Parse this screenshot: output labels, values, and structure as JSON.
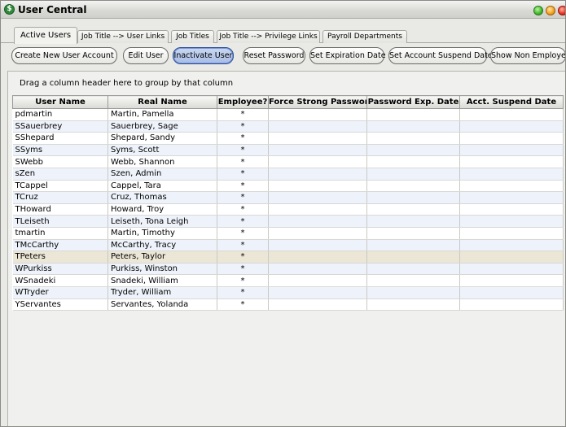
{
  "window": {
    "title": "User Central",
    "app_icon_glyph": "$"
  },
  "tabs": [
    {
      "label": "Active Users",
      "active": true
    },
    {
      "label": "Job Title --> User Links",
      "active": false
    },
    {
      "label": "Job Titles",
      "active": false
    },
    {
      "label": "Job Title --> Privilege Links",
      "active": false
    },
    {
      "label": "Payroll Departments",
      "active": false
    }
  ],
  "toolbar": {
    "create_label": "Create New User Account",
    "edit_label": "Edit User",
    "inactivate_label": "Inactivate User",
    "reset_password_label": "Reset Password",
    "set_expiration_label": "Set Expiration Date",
    "set_suspend_label": "Set Account Suspend Date",
    "show_non_employees_label": "Show Non Employees"
  },
  "grid": {
    "group_hint": "Drag a column header here to group by that column",
    "columns": [
      "User Name",
      "Real Name",
      "Employee?",
      "Force Strong Password?",
      "Password Exp. Date",
      "Acct. Suspend Date"
    ],
    "rows": [
      {
        "user": "pdmartin",
        "real": "Martin, Pamella",
        "employee": "*",
        "force": "",
        "exp": "",
        "suspend": ""
      },
      {
        "user": "SSauerbrey",
        "real": "Sauerbrey, Sage",
        "employee": "*",
        "force": "",
        "exp": "",
        "suspend": ""
      },
      {
        "user": "SShepard",
        "real": "Shepard, Sandy",
        "employee": "*",
        "force": "",
        "exp": "",
        "suspend": ""
      },
      {
        "user": "SSyms",
        "real": "Syms, Scott",
        "employee": "*",
        "force": "",
        "exp": "",
        "suspend": ""
      },
      {
        "user": "SWebb",
        "real": "Webb, Shannon",
        "employee": "*",
        "force": "",
        "exp": "",
        "suspend": ""
      },
      {
        "user": "sZen",
        "real": "Szen, Admin",
        "employee": "*",
        "force": "",
        "exp": "",
        "suspend": ""
      },
      {
        "user": "TCappel",
        "real": "Cappel, Tara",
        "employee": "*",
        "force": "",
        "exp": "",
        "suspend": ""
      },
      {
        "user": "TCruz",
        "real": "Cruz, Thomas",
        "employee": "*",
        "force": "",
        "exp": "",
        "suspend": ""
      },
      {
        "user": "THoward",
        "real": "Howard, Troy",
        "employee": "*",
        "force": "",
        "exp": "",
        "suspend": ""
      },
      {
        "user": "TLeiseth",
        "real": "Leiseth, Tona Leigh",
        "employee": "*",
        "force": "",
        "exp": "",
        "suspend": ""
      },
      {
        "user": "tmartin",
        "real": "Martin, Timothy",
        "employee": "*",
        "force": "",
        "exp": "",
        "suspend": ""
      },
      {
        "user": "TMcCarthy",
        "real": "McCarthy, Tracy",
        "employee": "*",
        "force": "",
        "exp": "",
        "suspend": ""
      },
      {
        "user": "TPeters",
        "real": "Peters, Taylor",
        "employee": "*",
        "force": "",
        "exp": "",
        "suspend": "",
        "highlight": true
      },
      {
        "user": "WPurkiss",
        "real": "Purkiss, Winston",
        "employee": "*",
        "force": "",
        "exp": "",
        "suspend": ""
      },
      {
        "user": "WSnadeki",
        "real": "Snadeki, William",
        "employee": "*",
        "force": "",
        "exp": "",
        "suspend": ""
      },
      {
        "user": "WTryder",
        "real": "Tryder, William",
        "employee": "*",
        "force": "",
        "exp": "",
        "suspend": ""
      },
      {
        "user": "YServantes",
        "real": "Servantes, Yolanda",
        "employee": "*",
        "force": "",
        "exp": "",
        "suspend": ""
      }
    ]
  },
  "colors": {
    "accent": "#2a4c9a",
    "row_alt": "#eef3fb",
    "row_highlight": "#ebe6d6"
  }
}
